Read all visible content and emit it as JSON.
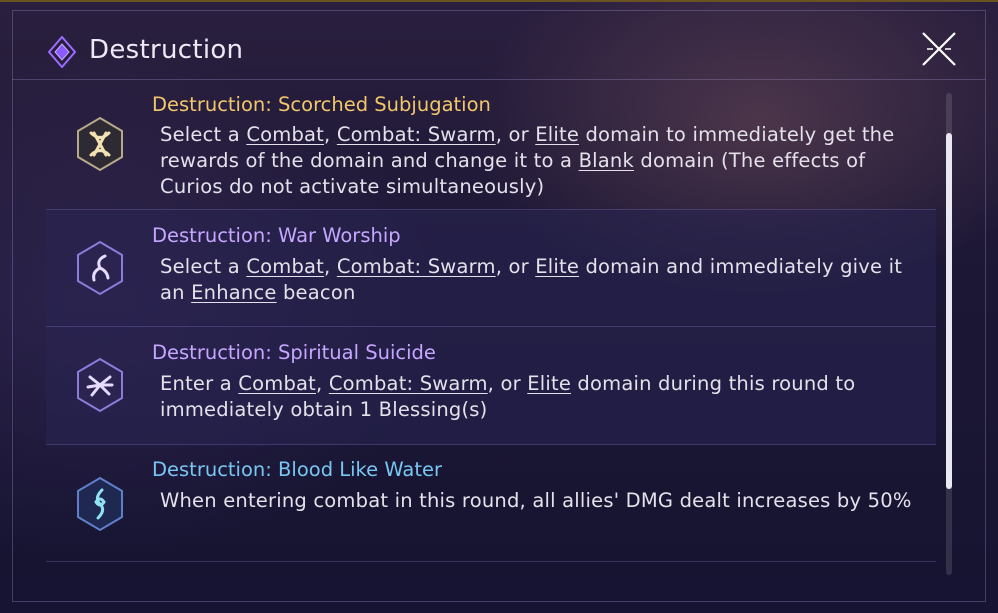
{
  "header": {
    "title": "Destruction",
    "icon": "diamond-emblem-icon",
    "close_icon": "close-icon"
  },
  "items": [
    {
      "title": "Destruction: Scorched Subjugation",
      "title_color": "#f2c76a",
      "icon": "scorched-subjugation-icon",
      "desc": {
        "p1": "Select a ",
        "l1": "Combat",
        "p2": ", ",
        "l2": "Combat: Swarm",
        "p3": ", or ",
        "l3": "Elite",
        "p4": " domain to immediately get the rewards of the domain and change it to a ",
        "l4": "Blank",
        "p5": " domain (The effects of Curios do not activate simultaneously)"
      }
    },
    {
      "title": "Destruction: War Worship",
      "title_color": "#c7a6ff",
      "icon": "war-worship-icon",
      "desc": {
        "p1": "Select a ",
        "l1": "Combat",
        "p2": ", ",
        "l2": "Combat: Swarm",
        "p3": ", or ",
        "l3": "Elite",
        "p4": " domain and immediately give it an ",
        "l4": "Enhance",
        "p5": " beacon"
      }
    },
    {
      "title": "Destruction: Spiritual Suicide",
      "title_color": "#c7a6ff",
      "icon": "spiritual-suicide-icon",
      "desc": {
        "p1": "Enter a ",
        "l1": "Combat",
        "p2": ", ",
        "l2": "Combat: Swarm",
        "p3": ", or ",
        "l3": "Elite",
        "p4": " domain during this round to immediately obtain 1 Blessing(s)"
      }
    },
    {
      "title": "Destruction: Blood Like Water",
      "title_color": "#79c6f2",
      "icon": "blood-like-water-icon",
      "desc": {
        "p1": "When entering combat in this round, all allies' DMG dealt increases by 50%"
      }
    }
  ],
  "colors": {
    "background": "#1c1735",
    "accent_purple": "#9b6bff",
    "text": "#e4e1ea"
  }
}
